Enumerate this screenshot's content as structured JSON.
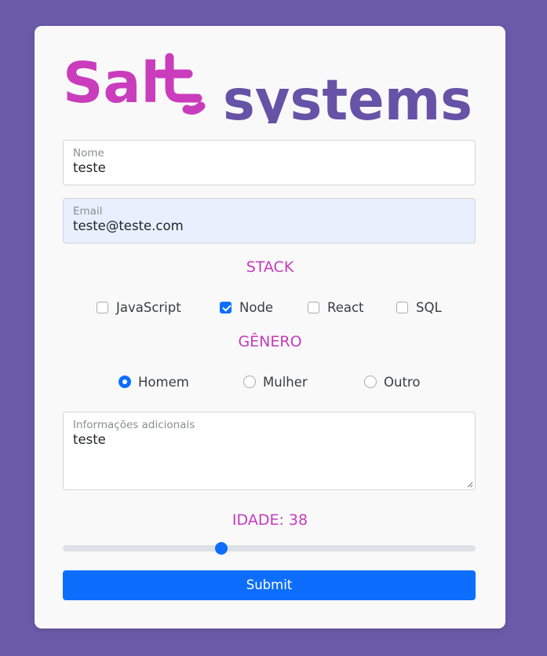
{
  "logo": {
    "brand": "Salt systems",
    "part_salt": "Sal",
    "part_systems": "systems",
    "color_salt": "#c93dbd",
    "color_systems": "#6652a6"
  },
  "form": {
    "nome": {
      "label": "Nome",
      "value": "teste"
    },
    "email": {
      "label": "Email",
      "value": "teste@teste.com"
    },
    "stack": {
      "title": "STACK",
      "options": [
        {
          "label": "JavaScript",
          "checked": false
        },
        {
          "label": "Node",
          "checked": true
        },
        {
          "label": "React",
          "checked": false
        },
        {
          "label": "SQL",
          "checked": false
        }
      ]
    },
    "genero": {
      "title": "GÊNERO",
      "options": [
        {
          "label": "Homem",
          "selected": true
        },
        {
          "label": "Mulher",
          "selected": false
        },
        {
          "label": "Outro",
          "selected": false
        }
      ]
    },
    "info": {
      "label": "Informações adicionais",
      "value": "teste"
    },
    "idade": {
      "title": "IDADE: 38",
      "value": 38,
      "min": 0,
      "max": 100
    },
    "submit_label": "Submit"
  },
  "colors": {
    "background": "#6a5aa8",
    "card": "#f9f9f9",
    "accent": "#c43cbb",
    "primary": "#0d6efd"
  }
}
